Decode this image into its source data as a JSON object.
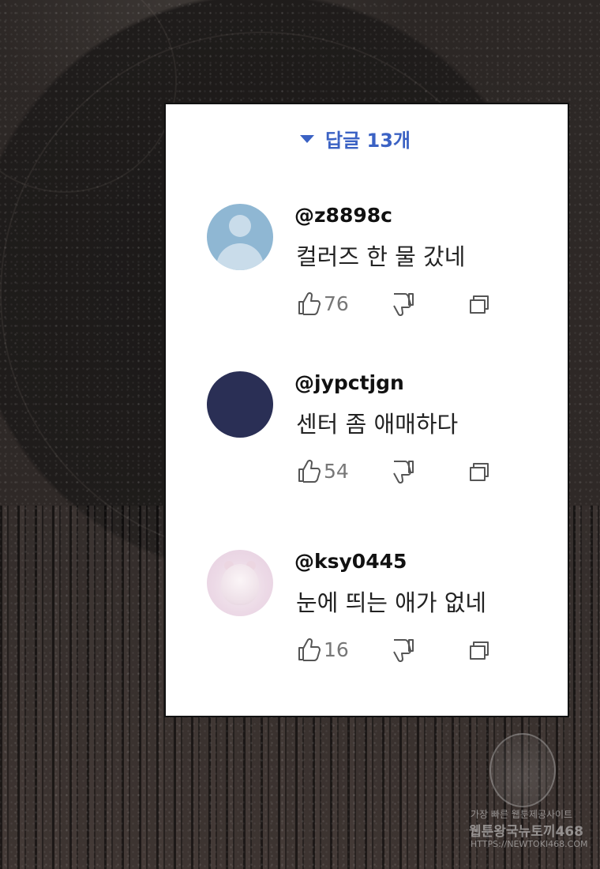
{
  "replies": {
    "label": "답글 13개"
  },
  "comments": [
    {
      "username": "@z8898c",
      "text": "컬러즈 한 물 갔네",
      "likes": "76",
      "avatar": "default-avatar"
    },
    {
      "username": "@jypctjgn",
      "text": "센터 좀 애매하다",
      "likes": "54",
      "avatar": "navy-avatar"
    },
    {
      "username": "@ksy0445",
      "text": "눈에 띄는 애가 없네",
      "likes": "16",
      "avatar": "hamster-photo-avatar"
    }
  ],
  "watermark": {
    "line1": "가장 빠른 웹툰제공사이트",
    "line2": "웹툰왕국뉴토끼468",
    "line3": "HTTPS://NEWTOKI468.COM"
  },
  "colors": {
    "accent": "#3b62c4",
    "card_bg": "#ffffff",
    "navy_avatar": "#2a2f55",
    "default_avatar": "#8fb7d3"
  }
}
